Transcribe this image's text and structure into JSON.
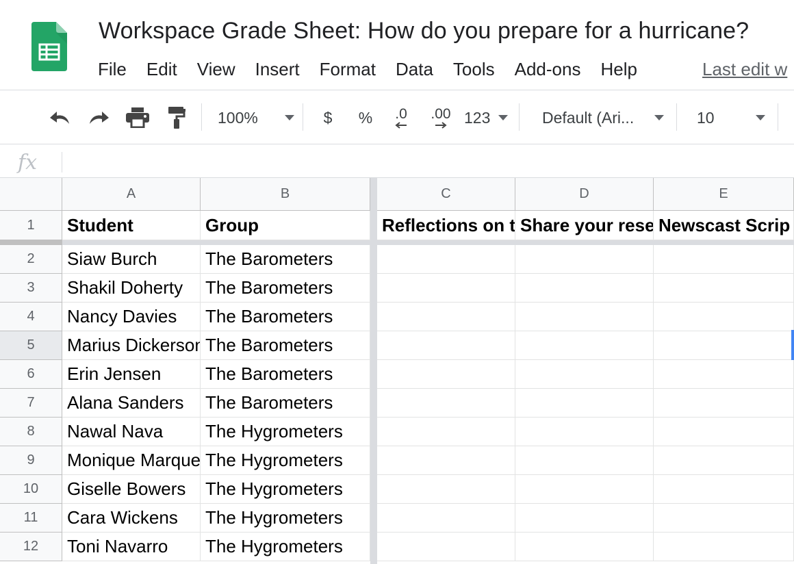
{
  "document": {
    "title": "Workspace Grade Sheet: How do you prepare for a hurricane?",
    "last_edit": "Last edit w"
  },
  "menu": [
    "File",
    "Edit",
    "View",
    "Insert",
    "Format",
    "Data",
    "Tools",
    "Add-ons",
    "Help"
  ],
  "toolbar": {
    "undo_icon": "undo-icon",
    "redo_icon": "redo-icon",
    "print_icon": "print-icon",
    "paint_format_icon": "paint-format-icon",
    "zoom": "100%",
    "currency": "$",
    "percent": "%",
    "decrease_decimal": ".0",
    "increase_decimal": ".00",
    "number_format": "123",
    "font": "Default (Ari...",
    "font_size": "10"
  },
  "formula_bar": {
    "label": "fx",
    "value": ""
  },
  "grid": {
    "columns": [
      "A",
      "B",
      "C",
      "D",
      "E"
    ],
    "rows": [
      "1",
      "2",
      "3",
      "4",
      "5",
      "6",
      "7",
      "8",
      "9",
      "10",
      "11",
      "12"
    ],
    "header_row": [
      "Student",
      "Group",
      "Reflections on t",
      "Share your rese",
      "Newscast Scrip"
    ],
    "data": [
      [
        "Siaw Burch",
        "The Barometers"
      ],
      [
        "Shakil Doherty",
        "The Barometers"
      ],
      [
        "Nancy Davies",
        "The Barometers"
      ],
      [
        "Marius Dickerson",
        "The Barometers"
      ],
      [
        "Erin Jensen",
        "The Barometers"
      ],
      [
        "Alana Sanders",
        "The Barometers"
      ],
      [
        "Nawal Nava",
        "The Hygrometers"
      ],
      [
        "Monique Marquez",
        "The Hygrometers"
      ],
      [
        "Giselle Bowers",
        "The Hygrometers"
      ],
      [
        "Cara Wickens",
        "The Hygrometers"
      ],
      [
        "Toni Navarro",
        "The Hygrometers"
      ]
    ]
  },
  "colors": {
    "sheets_green": "#0f9d58",
    "selection_blue": "#4285f4"
  }
}
